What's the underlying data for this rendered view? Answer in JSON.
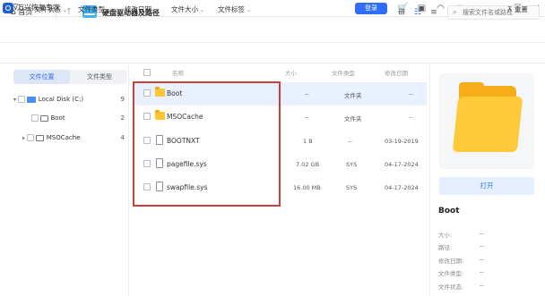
{
  "app": {
    "title": "万兴恢复专家",
    "login_label": "登录"
  },
  "nav": {
    "home_label": "首页",
    "path_title": "硬盘驱动器及路径",
    "search_placeholder": "搜索文件名或路径"
  },
  "filters": {
    "items": [
      "文件状态",
      "文件类型",
      "修改日期",
      "文件大小",
      "文件标签"
    ],
    "reset_label": "重置"
  },
  "left": {
    "tabs": {
      "location": "文件位置",
      "type": "文件类型"
    },
    "tree": [
      {
        "label": "Local Disk (C:)",
        "count": "9"
      },
      {
        "label": "Boot",
        "count": "2"
      },
      {
        "label": "MSOCache",
        "count": "4"
      }
    ]
  },
  "list": {
    "columns": {
      "name": "名称",
      "size": "大小",
      "type": "文件类型",
      "date": "修改日期"
    },
    "rows": [
      {
        "name": "Boot",
        "size": "--",
        "type": "文件夹",
        "date": "--",
        "kind": "folder"
      },
      {
        "name": "MSOCache",
        "size": "--",
        "type": "文件夹",
        "date": "--",
        "kind": "folder"
      },
      {
        "name": "BOOTNXT",
        "size": "1 B",
        "type": "--",
        "date": "03-19-2019",
        "kind": "file"
      },
      {
        "name": "pagefile.sys",
        "size": "7.02 GB",
        "type": "SYS",
        "date": "04-17-2024",
        "kind": "file"
      },
      {
        "name": "swapfile.sys",
        "size": "16.00 MB",
        "type": "SYS",
        "date": "04-17-2024",
        "kind": "file"
      }
    ]
  },
  "details": {
    "open_label": "打开",
    "name": "Boot",
    "fields": [
      {
        "key": "大小:",
        "value": "--"
      },
      {
        "key": "路径:",
        "value": "--"
      },
      {
        "key": "修改日期:",
        "value": "--"
      },
      {
        "key": "文件类型:",
        "value": "--"
      },
      {
        "key": "文件状态:",
        "value": "--"
      }
    ]
  },
  "colors": {
    "accent": "#2f6df6",
    "highlight_box": "#c9413b",
    "folder": "#ffc535"
  }
}
